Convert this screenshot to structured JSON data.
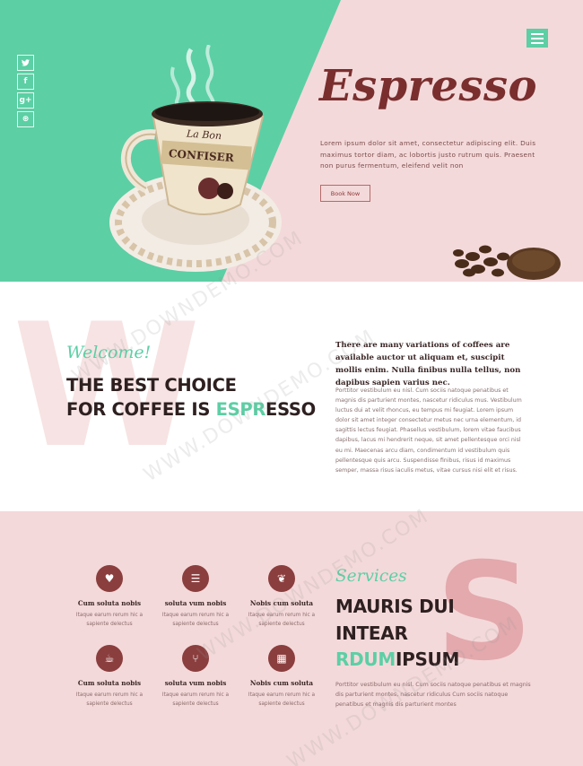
{
  "colors": {
    "mint": "#5ccfa5",
    "pink": "#f4d9da",
    "brown": "#7a2e2e",
    "dark": "#2e2020"
  },
  "hero": {
    "title": "Espresso",
    "text": "Lorem ipsum dolor sit amet, consectetur adipiscing elit. Duis maximus tortor diam, ac lobortis justo rutrum quis. Praesent non purus fermentum, eleifend velit non",
    "button": "Book Now",
    "social": [
      {
        "icon": "twitter-icon",
        "glyph": "🐦"
      },
      {
        "icon": "facebook-icon",
        "glyph": "f"
      },
      {
        "icon": "google-plus-icon",
        "glyph": "g+"
      },
      {
        "icon": "dribbble-icon",
        "glyph": "⊛"
      }
    ]
  },
  "welcome": {
    "bg_letter": "W",
    "label": "Welcome!",
    "heading_line1": "THE BEST CHOICE",
    "heading_line2_pre": "FOR COFFEE IS ",
    "heading_accent": "ESPR",
    "heading_post": "ESSO",
    "lead": "There are many variations of coffees are available auctor ut aliquam et, suscipit mollis enim. Nulla finibus nulla tellus, non dapibus sapien varius nec.",
    "body": "Porttitor vestibulum eu nisl. Cum sociis natoque penatibus et magnis dis parturient montes, nascetur ridiculus mus. Vestibulum luctus dui at velit rhoncus, eu tempus mi feugiat. Lorem ipsum dolor sit amet integer consectetur metus nec urna elementum, id sagittis lectus feugiat. Phasellus vestibulum, lorem vitae faucibus dapibus, lacus mi hendrerit neque, sit amet pellentesque orci nisl eu mi. Maecenas arcu diam, condimentum id vestibulum quis pellentesque quis arcu. Suspendisse finibus, risus id maximus semper, massa risus iaculis metus, vitae cursus nisi elit et risus."
  },
  "services": {
    "bg_letter": "S",
    "label": "Services",
    "heading_line1": "MAURIS DUI",
    "heading_line2": "INTEAR",
    "heading_accent": "RDUM",
    "heading_post": "IPSUM",
    "body": "Porttitor vestibulum eu nisl. Cum sociis natoque penatibus et magnis dis parturient montes, nascetur ridiculus Cum sociis natoque penatibus et magnis dis parturient montes",
    "items": [
      {
        "icon": "heart-icon",
        "glyph": "♥",
        "title": "Cum soluta nobis",
        "text": "Itaque earum rerum hic a sapiente delectus"
      },
      {
        "icon": "list-icon",
        "glyph": "☰",
        "title": "soluta vum nobis",
        "text": "Itaque earum rerum hic a sapiente delectus"
      },
      {
        "icon": "leaf-icon",
        "glyph": "❦",
        "title": "Nobis cum soluta",
        "text": "Itaque earum rerum hic a sapiente delectus"
      },
      {
        "icon": "cup-icon",
        "glyph": "☕",
        "title": "Cum soluta nobis",
        "text": "Itaque earum rerum hic a sapiente delectus"
      },
      {
        "icon": "cutlery-icon",
        "glyph": "⑂",
        "title": "soluta vum nobis",
        "text": "Itaque earum rerum hic a sapiente delectus"
      },
      {
        "icon": "grid-icon",
        "glyph": "▦",
        "title": "Nobis cum soluta",
        "text": "Itaque earum rerum hic a sapiente delectus"
      }
    ]
  },
  "watermark": "WWW.DOWNDEMO.COM"
}
